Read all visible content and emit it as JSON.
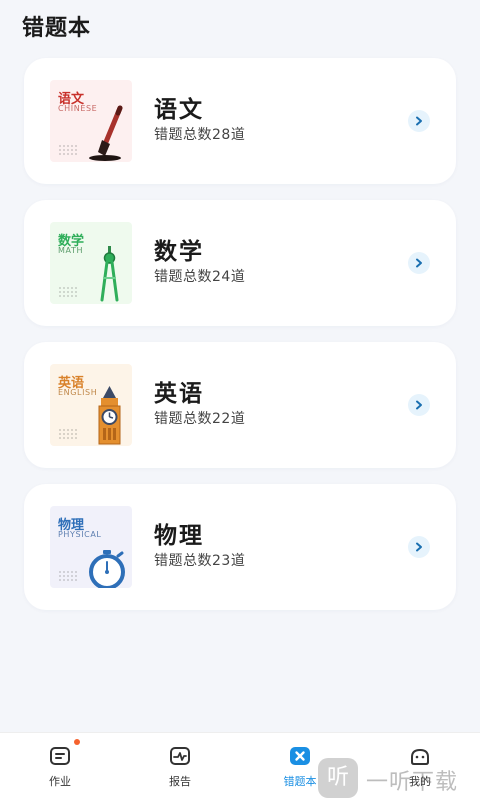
{
  "header": {
    "title": "错题本"
  },
  "subjects": [
    {
      "name": "语文",
      "count_text": "错题总数28道",
      "thumb_cn": "语文",
      "thumb_en": "CHINESE",
      "thumb_icon": "calligraphy-brush-icon"
    },
    {
      "name": "数学",
      "count_text": "错题总数24道",
      "thumb_cn": "数学",
      "thumb_en": "MATH",
      "thumb_icon": "compass-icon"
    },
    {
      "name": "英语",
      "count_text": "错题总数22道",
      "thumb_cn": "英语",
      "thumb_en": "ENGLISH",
      "thumb_icon": "big-ben-icon"
    },
    {
      "name": "物理",
      "count_text": "错题总数23道",
      "thumb_cn": "物理",
      "thumb_en": "PHYSICAL",
      "thumb_icon": "stopwatch-icon"
    }
  ],
  "tabbar": {
    "tabs": [
      {
        "label": "作业",
        "icon": "homework-icon",
        "badge": true
      },
      {
        "label": "报告",
        "icon": "report-icon"
      },
      {
        "label": "错题本",
        "icon": "mistake-book-icon",
        "active": true
      },
      {
        "label": "我的",
        "icon": "profile-icon"
      }
    ]
  },
  "watermark": {
    "glyph": "听",
    "text": "一听下载"
  },
  "colors": {
    "accent": "#1a8fe3",
    "badge": "#f5622d",
    "background": "#f4f6fa",
    "chinese_accent": "#c8312b",
    "math_accent": "#2fae5a",
    "english_accent": "#d9822b",
    "physics_accent": "#2e6fb8"
  }
}
